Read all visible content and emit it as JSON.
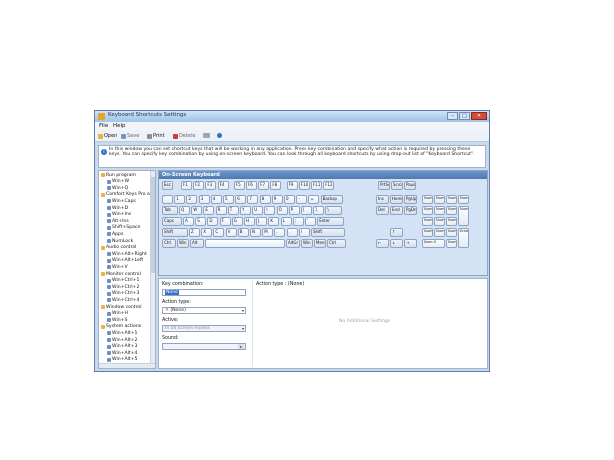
{
  "window": {
    "title": "Keyboard Shortcuts Settings",
    "controls": {
      "minimize": "–",
      "maximize": "□",
      "close": "✕"
    }
  },
  "menu": {
    "file": "File",
    "help": "Help"
  },
  "toolbar": {
    "open": "Open",
    "save": "Save",
    "print": "Print",
    "delete": "Delete"
  },
  "info": {
    "icon": "i",
    "text": "In this window you can set shortcut keys that will be working in any application. Press key combination and specify what action is required by pressing these keys. You can specify key combination by using on-screen keyboard. You can look through all keyboard shortcuts by using drop-out list of \"Keyboard Shortcut\"."
  },
  "tree": {
    "items": [
      {
        "label": "Run program",
        "level": 0,
        "icon": "folder-icon"
      },
      {
        "label": "Win+W",
        "level": 1,
        "icon": "shortcut-icon"
      },
      {
        "label": "Win+Q",
        "level": 1,
        "icon": "shortcut-icon"
      },
      {
        "label": "Comfort Keys Pro a",
        "level": 0,
        "icon": "folder-icon"
      },
      {
        "label": "Win+Caps",
        "level": 1,
        "icon": "shortcut-icon"
      },
      {
        "label": "Win+D",
        "level": 1,
        "icon": "shortcut-icon"
      },
      {
        "label": "Win+Ins",
        "level": 1,
        "icon": "shortcut-icon"
      },
      {
        "label": "Alt+Ins",
        "level": 1,
        "icon": "shortcut-icon"
      },
      {
        "label": "Shift+Space",
        "level": 1,
        "icon": "shortcut-icon"
      },
      {
        "label": "Apps",
        "level": 1,
        "icon": "shortcut-icon"
      },
      {
        "label": "NumLock",
        "level": 1,
        "icon": "shortcut-icon"
      },
      {
        "label": "Audio control",
        "level": 0,
        "icon": "folder-icon"
      },
      {
        "label": "Win+Alt+Right",
        "level": 1,
        "icon": "shortcut-icon"
      },
      {
        "label": "Win+Alt+Left",
        "level": 1,
        "icon": "shortcut-icon"
      },
      {
        "label": "Win+V",
        "level": 1,
        "icon": "shortcut-icon"
      },
      {
        "label": "Monitor control",
        "level": 0,
        "icon": "folder-icon"
      },
      {
        "label": "Win+Ctrl+1",
        "level": 1,
        "icon": "shortcut-icon"
      },
      {
        "label": "Win+Ctrl+2",
        "level": 1,
        "icon": "shortcut-icon"
      },
      {
        "label": "Win+Ctrl+3",
        "level": 1,
        "icon": "shortcut-icon"
      },
      {
        "label": "Win+Ctrl+4",
        "level": 1,
        "icon": "shortcut-icon"
      },
      {
        "label": "Window control",
        "level": 0,
        "icon": "folder-icon"
      },
      {
        "label": "Win+H",
        "level": 1,
        "icon": "shortcut-icon"
      },
      {
        "label": "Win+S",
        "level": 1,
        "icon": "shortcut-icon"
      },
      {
        "label": "System actions",
        "level": 0,
        "icon": "folder-icon"
      },
      {
        "label": "Win+Alt+1",
        "level": 1,
        "icon": "shortcut-icon"
      },
      {
        "label": "Win+Alt+2",
        "level": 1,
        "icon": "shortcut-icon"
      },
      {
        "label": "Win+Alt+3",
        "level": 1,
        "icon": "shortcut-icon"
      },
      {
        "label": "Win+Alt+4",
        "level": 1,
        "icon": "shortcut-icon"
      },
      {
        "label": "Win+Alt+5",
        "level": 1,
        "icon": "shortcut-icon"
      }
    ]
  },
  "keyboard": {
    "title": "On-Screen Keyboard",
    "fn_row": [
      "Esc",
      "F1",
      "F2",
      "F3",
      "F4",
      "F5",
      "F6",
      "F7",
      "F8",
      "F9",
      "F10",
      "F11",
      "F12",
      "PrtSc",
      "Scroll",
      "Pause"
    ],
    "number_row": [
      "`",
      "1",
      "2",
      "3",
      "4",
      "5",
      "6",
      "7",
      "8",
      "9",
      "0",
      "-",
      "=",
      "Backsp"
    ],
    "qwerty_row": [
      "Tab",
      "Q",
      "W",
      "E",
      "R",
      "T",
      "Y",
      "U",
      "I",
      "O",
      "P",
      "[",
      "]",
      "\\"
    ],
    "home_row": [
      "Caps",
      "A",
      "S",
      "D",
      "F",
      "G",
      "H",
      "J",
      "K",
      "L",
      ";",
      "'",
      "Enter"
    ],
    "shift_row": [
      "Shift",
      "Z",
      "X",
      "C",
      "V",
      "B",
      "N",
      "M",
      ",",
      ".",
      "/",
      "Shift"
    ],
    "bottom_row": [
      "Ctrl",
      "Win",
      "Alt",
      "",
      "AltGr",
      "Win",
      "Menu",
      "Ctrl"
    ],
    "nav": [
      "Ins",
      "Home",
      "PgUp",
      "Del",
      "End",
      "PgDn"
    ],
    "arrows": [
      "↑",
      "←",
      "↓",
      "→"
    ],
    "numpad": [
      "Num Lk",
      "Num /",
      "Num *",
      "Num -",
      "Num 7",
      "Num 8",
      "Num 9",
      "Num +",
      "Num 4",
      "Num 5",
      "Num 6",
      "Num 1",
      "Num 2",
      "Num 3",
      "Enter",
      "Num 0",
      "Num ."
    ]
  },
  "settings": {
    "key_combination_label": "Key combination:",
    "key_combination_value": "None",
    "action_type_label": "Action type:",
    "action_type_value": "(None)",
    "active_label": "Active:",
    "active_value": "In all screen modes",
    "sound_label": "Sound:",
    "sound_value": "",
    "action_type_header": "Action type : (None)",
    "no_settings": "No Additional Settings"
  },
  "colors": {
    "accent": "#4d78b0",
    "info_icon": "#2d6fcf",
    "close": "#d24d3a"
  }
}
